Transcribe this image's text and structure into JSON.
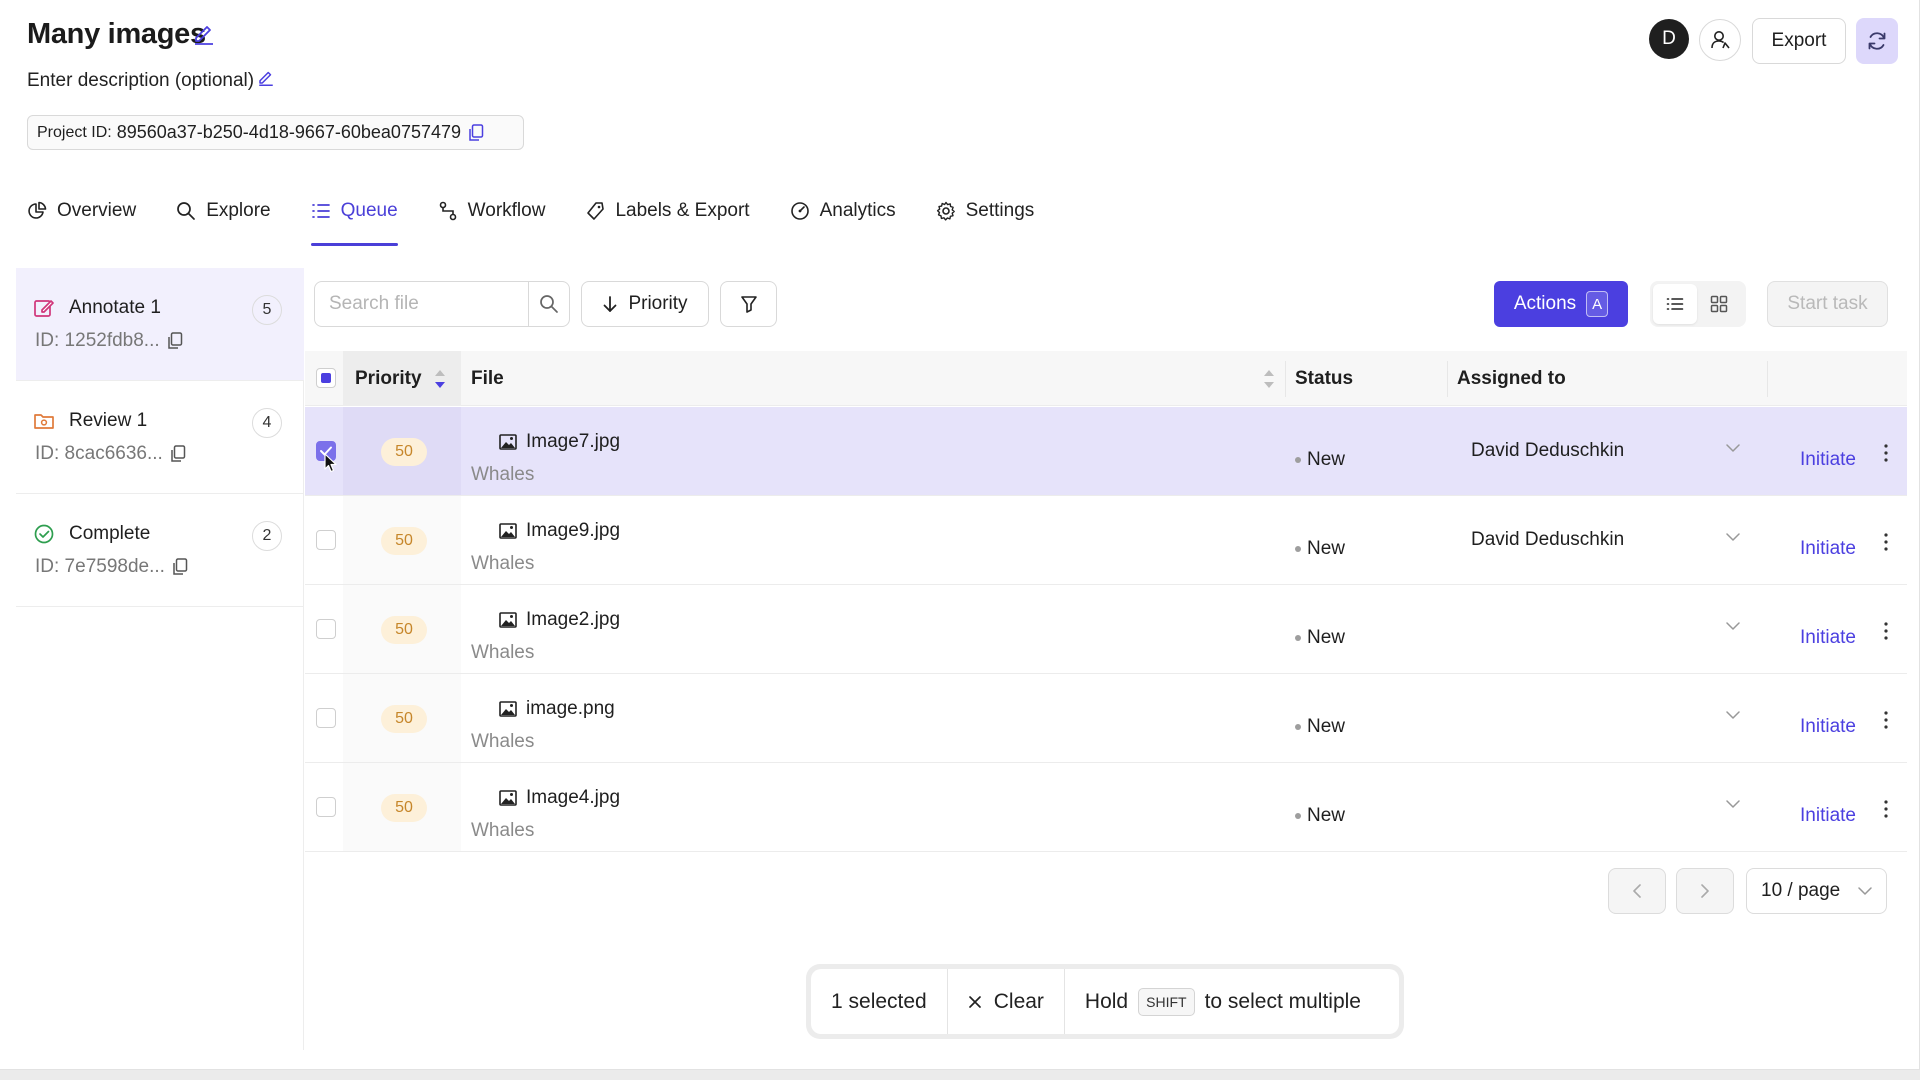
{
  "project": {
    "title": "Many images",
    "description": "Enter description (optional)",
    "id_label": "Project ID:",
    "id_value": "89560a37-b250-4d18-9667-60bea0757479"
  },
  "header": {
    "avatar_letter": "D",
    "export_label": "Export"
  },
  "tabs": [
    {
      "label": "Overview",
      "icon": "pie-chart-icon"
    },
    {
      "label": "Explore",
      "icon": "search-icon"
    },
    {
      "label": "Queue",
      "icon": "list-icon",
      "active": true
    },
    {
      "label": "Workflow",
      "icon": "workflow-icon"
    },
    {
      "label": "Labels & Export",
      "icon": "tag-icon"
    },
    {
      "label": "Analytics",
      "icon": "gauge-icon"
    },
    {
      "label": "Settings",
      "icon": "gear-icon"
    }
  ],
  "stages": [
    {
      "name": "Annotate 1",
      "id": "ID: 1252fdb8...",
      "count": "5",
      "icon": "edit-square-icon",
      "active": true
    },
    {
      "name": "Review 1",
      "id": "ID: 8cac6636...",
      "count": "4",
      "icon": "review-folder-icon"
    },
    {
      "name": "Complete",
      "id": "ID: 7e7598de...",
      "count": "2",
      "icon": "check-circle-icon"
    }
  ],
  "toolbar": {
    "search_placeholder": "Search file",
    "sort_label": "Priority",
    "actions_label": "Actions",
    "actions_shortcut": "A",
    "start_task_label": "Start task"
  },
  "table": {
    "columns": {
      "priority": "Priority",
      "file": "File",
      "status": "Status",
      "assigned": "Assigned to"
    },
    "rows": [
      {
        "priority": "50",
        "file": "Image7.jpg",
        "group": "Whales",
        "status": "New",
        "assignee": "David Deduschkin",
        "action": "Initiate",
        "selected": true
      },
      {
        "priority": "50",
        "file": "Image9.jpg",
        "group": "Whales",
        "status": "New",
        "assignee": "David Deduschkin",
        "action": "Initiate",
        "selected": false
      },
      {
        "priority": "50",
        "file": "Image2.jpg",
        "group": "Whales",
        "status": "New",
        "assignee": "",
        "action": "Initiate",
        "selected": false
      },
      {
        "priority": "50",
        "file": "image.png",
        "group": "Whales",
        "status": "New",
        "assignee": "",
        "action": "Initiate",
        "selected": false
      },
      {
        "priority": "50",
        "file": "Image4.jpg",
        "group": "Whales",
        "status": "New",
        "assignee": "",
        "action": "Initiate",
        "selected": false
      }
    ]
  },
  "pagination": {
    "page_size": "10 / page"
  },
  "selection_bar": {
    "selected": "1 selected",
    "clear": "Clear",
    "hold": "Hold",
    "key": "SHIFT",
    "hint": "to select multiple"
  },
  "colors": {
    "accent": "#4b3fe0",
    "priority_badge": "#fdf0d9",
    "selected_row": "#e6e3fa"
  }
}
